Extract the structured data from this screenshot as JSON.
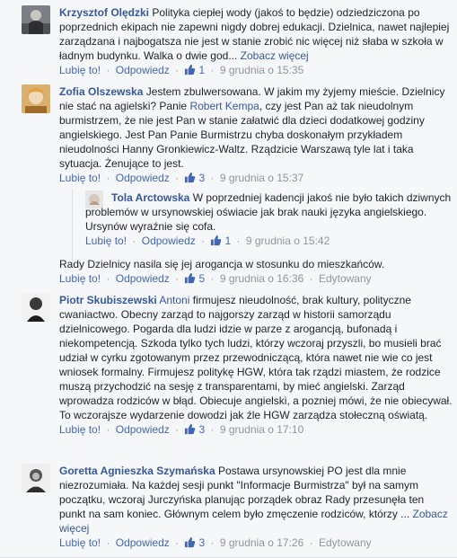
{
  "comments": [
    {
      "author": "Krzysztof Olędzki",
      "text": "Polityka ciepłej wody (jakoś to będzie) odziedziczona po poprzednich ekipach nie zapewni nigdy dobrej edukacji. Dzielnica, nawet najlepiej zarządzana i najbogatsza nie jest w stanie zrobić nic więcej niż słaba w szkoła w ładnym budynku. Walka o dwie god...",
      "see_more": "Zobacz więcej",
      "like": "Lubię to!",
      "reply": "Odpowiedz",
      "likes": "1",
      "time": "9 grudnia o 15:35"
    },
    {
      "author": "Zofia Olszewska",
      "text1": "Jestem zbulwersowana. W jakim my żyjemy mieście. Dzielnicy nie stać na agielski? Panie ",
      "mention": "Robert Kempa",
      "text2": ", czy jest Pan aż tak nieudolnym burmistrzem, że nie jest Pan w stanie załatwić dla dzieci dodatkowej godziny angielskiego. Jest Pan Panie Burmistrzu chyba doskonałym przykładem nieudolności Hanny Gronkiewicz-Waltz. Rządzicie Warszawą tyle lat i taka sytuacja. Żenujące to jest.",
      "like": "Lubię to!",
      "reply": "Odpowiedz",
      "likes": "3",
      "time": "9 grudnia o 15:37"
    },
    {
      "author": "Tola Arctowska",
      "text": "W poprzedniej kadencji jakoś nie było takich dziwnych problemów w ursynowskiej oświacie jak brak nauki języka angielskiego. Ursynów wyraźnie się cofa.",
      "like": "Lubię to!",
      "reply": "Odpowiedz",
      "likes": "1",
      "time": "9 grudnia o 15:42"
    },
    {
      "text": "Rady Dzielnicy nasila się jej arogancja w stosunku do mieszkańców.",
      "like": "Lubię to!",
      "reply": "Odpowiedz",
      "likes": "5",
      "time": "9 grudnia o 16:36",
      "edited": "Edytowany"
    },
    {
      "author": "Piotr Skubiszewski",
      "mention": "Antoni",
      "text": "firmujesz nieudolność, brak kultury, polityczne cwaniactwo. Obecny zarząd to najgorszy zarząd w historii samorządu dzielnicowego. Pogarda dla ludzi idzie w parze z arogancją, bufonadą i niekompetencją. Szkoda tylko tych ludzi, którzy wczoraj przyszli, bo musieli brać udział w cyrku zgotowanym przez przewodniczącą, która nawet nie wie co jest wniosek formalny. Firmujesz politykę HGW, która tak rządzi miastem, że rodzice muszą przychodzić na sesję z transparentami, by mieć angielski. Zarząd wprowadza rodziców w błąd. Obiecuje angielski, a pozniej mówi, że nie obiecywał. To wczorajsze wydarzenie dowodzi jak źle HGW zarządza stołeczną oświatą.",
      "like": "Lubię to!",
      "reply": "Odpowiedz",
      "likes": "3",
      "time": "9 grudnia o 17:10"
    },
    {
      "author": "Goretta Agnieszka Szymańska",
      "text": "Postawa ursynowskiej PO jest dla mnie niezrozumiała. Na każdej sesji punkt \"Informacje Burmistrza\" był na samym początku, wczoraj Jurczyńska planując porządek obraz Rady przesunęła ten punkt na sam koniec. Głównym celem było zmęczenie rodziców, którzy ...",
      "see_more": "Zobacz więcej",
      "like": "Lubię to!",
      "reply": "Odpowiedz",
      "likes": "3",
      "time": "9 grudnia o 17:26",
      "edited": "Edytowany"
    }
  ],
  "colors": {
    "link": "#365899",
    "action": "#4267b2",
    "meta": "#90949c",
    "background": "#f6f7f9"
  },
  "icons": [
    "user-avatar-icon",
    "thumbs-up-icon"
  ]
}
